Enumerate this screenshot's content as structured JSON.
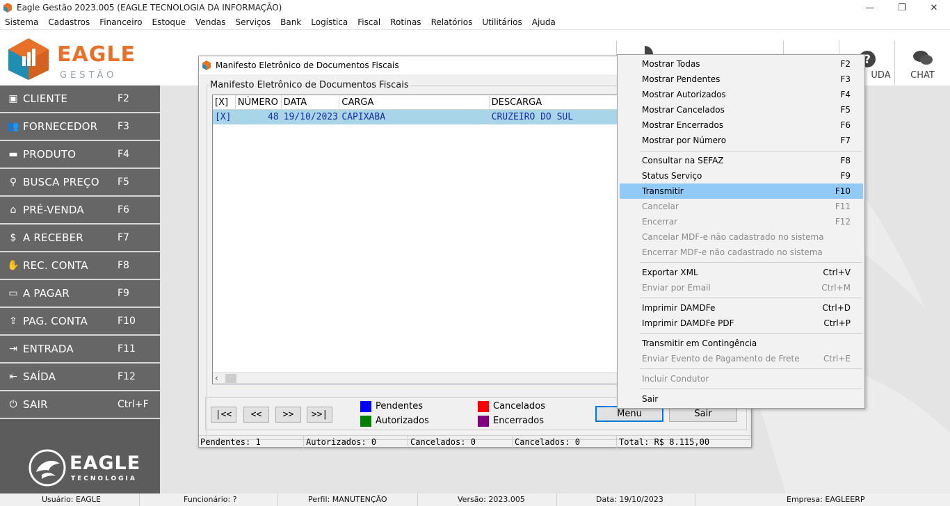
{
  "window": {
    "title": "Eagle Gestão 2023.005 (EAGLE TECNOLOGIA DA INFORMAÇÃO)",
    "minimize": "—",
    "restore": "❐",
    "close": "✕"
  },
  "menubar": [
    "Sistema",
    "Cadastros",
    "Financeiro",
    "Estoque",
    "Vendas",
    "Serviços",
    "Bank",
    "Logística",
    "Fiscal",
    "Rotinas",
    "Relatórios",
    "Utilitários",
    "Ajuda"
  ],
  "logo": {
    "brand": "EAGLE",
    "sub": "GESTÃO"
  },
  "toptools": {
    "ajuda": "UDA",
    "chat": "CHAT"
  },
  "sidebar": {
    "items": [
      {
        "label": "CLIENTE",
        "key": "F2",
        "icon": "id-card-icon"
      },
      {
        "label": "FORNECEDOR",
        "key": "F3",
        "icon": "users-icon"
      },
      {
        "label": "PRODUTO",
        "key": "F4",
        "icon": "box-icon"
      },
      {
        "label": "BUSCA PREÇO",
        "key": "F5",
        "icon": "search-icon"
      },
      {
        "label": "PRÉ-VENDA",
        "key": "F6",
        "icon": "basket-icon"
      },
      {
        "label": "A RECEBER",
        "key": "F7",
        "icon": "dollar-icon"
      },
      {
        "label": "REC. CONTA",
        "key": "F8",
        "icon": "hand-coin-icon"
      },
      {
        "label": "A PAGAR",
        "key": "F9",
        "icon": "wallet-icon"
      },
      {
        "label": "PAG. CONTA",
        "key": "F10",
        "icon": "upload-icon"
      },
      {
        "label": "ENTRADA",
        "key": "F11",
        "icon": "sign-in-icon"
      },
      {
        "label": "SAÍDA",
        "key": "F12",
        "icon": "sign-out-icon"
      },
      {
        "label": "SAIR",
        "key": "Ctrl+F",
        "icon": "power-icon"
      }
    ],
    "footer_brand": "EAGLE",
    "footer_sub": "TECNOLOGIA"
  },
  "statusbar": {
    "usuario": "Usuário: EAGLE",
    "funcionario": "Funcionário: ?",
    "perfil": "Perfil: MANUTENÇÃO",
    "versao": "Versão: 2023.005",
    "data": "Data: 19/10/2023",
    "empresa": "Empresa: EAGLEERP"
  },
  "dialog": {
    "title": "Manifesto Eletrônico de Documentos Fiscais",
    "group_label": "Manifesto Eletrônico de Documentos Fiscais",
    "columns": [
      "[X]",
      "NÚMERO",
      "DATA",
      "CARGA",
      "DESCARGA"
    ],
    "rows": [
      {
        "sel": "[X]",
        "numero": "48",
        "data": "19/10/2023",
        "carga": "CAPIXABA",
        "descarga": "CRUZEIRO DO SUL"
      }
    ],
    "nav": {
      "first": "|<<",
      "prev": "<<",
      "next": ">>",
      "last": ">>|"
    },
    "legend": {
      "pendentes": "Pendentes",
      "autorizados": "Autorizados",
      "cancelados": "Cancelados",
      "encerrados": "Encerrados",
      "colors": {
        "pendentes": "#0000ff",
        "autorizados": "#008000",
        "cancelados": "#ff0000",
        "encerrados": "#800080"
      }
    },
    "buttons": {
      "menu": "Menu",
      "sair": "Sair"
    },
    "status": {
      "pendentes": "Pendentes: 1",
      "autorizados": "Autorizados: 0",
      "cancelados1": "Cancelados: 0",
      "cancelados2": "Cancelados: 0",
      "total": "Total: R$ 8.115,00"
    }
  },
  "context_menu": {
    "items": [
      {
        "label": "Mostrar Todas",
        "key": "F2",
        "disabled": false
      },
      {
        "label": "Mostrar Pendentes",
        "key": "F3",
        "disabled": false
      },
      {
        "label": "Mostrar Autorizados",
        "key": "F4",
        "disabled": false
      },
      {
        "label": "Mostrar Cancelados",
        "key": "F5",
        "disabled": false
      },
      {
        "label": "Mostrar Encerrados",
        "key": "F6",
        "disabled": false
      },
      {
        "label": "Mostrar por Número",
        "key": "F7",
        "disabled": false
      },
      {
        "label": "Consultar na SEFAZ",
        "key": "F8",
        "disabled": false
      },
      {
        "label": "Status Serviço",
        "key": "F9",
        "disabled": false
      },
      {
        "label": "Transmitir",
        "key": "F10",
        "disabled": false,
        "highlighted": true
      },
      {
        "label": "Cancelar",
        "key": "F11",
        "disabled": true
      },
      {
        "label": "Encerrar",
        "key": "F12",
        "disabled": true
      },
      {
        "label": "Cancelar MDF-e não cadastrado no sistema",
        "key": "",
        "disabled": true
      },
      {
        "label": "Encerrar MDF-e não cadastrado no sistema",
        "key": "",
        "disabled": true
      },
      {
        "label": "Exportar XML",
        "key": "Ctrl+V",
        "disabled": false
      },
      {
        "label": "Enviar por Email",
        "key": "Ctrl+M",
        "disabled": true
      },
      {
        "label": "Imprimir DAMDFe",
        "key": "Ctrl+D",
        "disabled": false
      },
      {
        "label": "Imprimir DAMDFe PDF",
        "key": "Ctrl+P",
        "disabled": false
      },
      {
        "label": "Transmitir em Contingência",
        "key": "",
        "disabled": false
      },
      {
        "label": "Enviar Evento de Pagamento de Frete",
        "key": "Ctrl+E",
        "disabled": true
      },
      {
        "label": "Incluir Condutor",
        "key": "",
        "disabled": true
      },
      {
        "label": "Sair",
        "key": "",
        "disabled": false
      }
    ]
  },
  "colors": {
    "accent": "#e8712a",
    "sidebar": "#666666",
    "highlight": "#91c9f7",
    "grid_selected": "#a8d6e8"
  }
}
